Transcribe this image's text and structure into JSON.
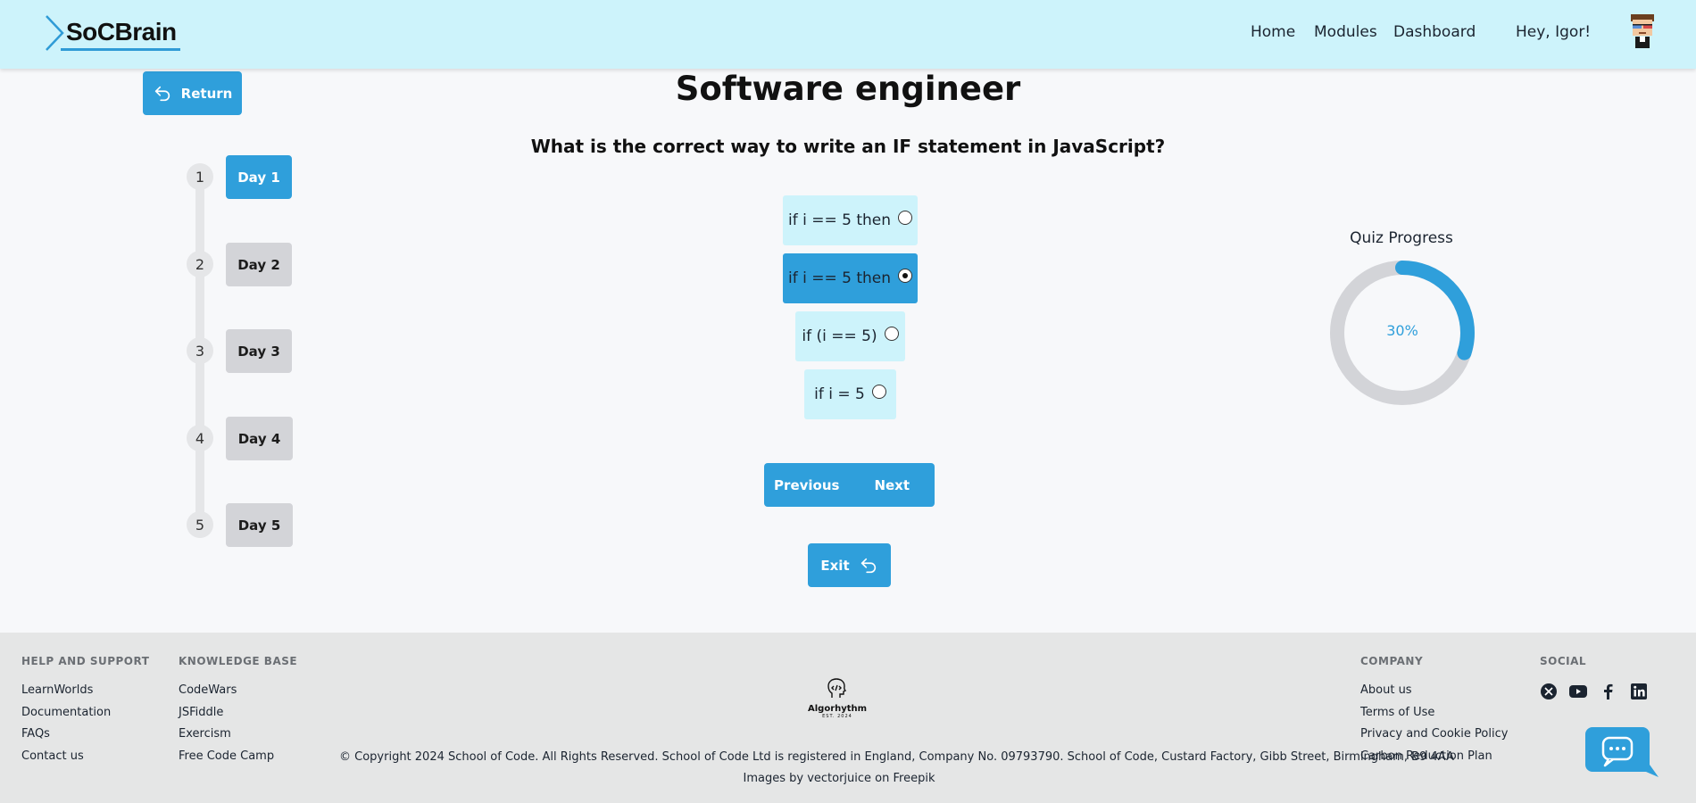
{
  "header": {
    "logo_text": "SoCBrain",
    "nav": [
      "Home",
      "Modules",
      "Dashboard"
    ],
    "greeting": "Hey, Igor!"
  },
  "return_label": "Return",
  "title": "Software engineer",
  "question": "What is the correct way to write an IF statement in JavaScript?",
  "days": [
    {
      "num": "1",
      "label": "Day 1",
      "active": true
    },
    {
      "num": "2",
      "label": "Day 2",
      "active": false
    },
    {
      "num": "3",
      "label": "Day 3",
      "active": false
    },
    {
      "num": "4",
      "label": "Day 4",
      "active": false
    },
    {
      "num": "5",
      "label": "Day 5",
      "active": false
    }
  ],
  "options": [
    {
      "label": "if i == 5 then",
      "selected": false
    },
    {
      "label": "if i == 5 then",
      "selected": true
    },
    {
      "label": "if (i == 5)",
      "selected": false
    },
    {
      "label": "if i = 5",
      "selected": false
    }
  ],
  "pager": {
    "previous": "Previous",
    "next": "Next"
  },
  "exit_label": "Exit",
  "progress": {
    "label": "Quiz Progress",
    "value_text": "30%",
    "fraction": 0.3
  },
  "footer": {
    "help": {
      "heading": "HELP AND SUPPORT",
      "links": [
        "LearnWorlds",
        "Documentation",
        "FAQs",
        "Contact us"
      ]
    },
    "knowledge": {
      "heading": "KNOWLEDGE BASE",
      "links": [
        "CodeWars",
        "JSFiddle",
        "Exercism",
        "Free Code Camp"
      ]
    },
    "company": {
      "heading": "COMPANY",
      "links": [
        "About us",
        "Terms of Use",
        "Privacy and Cookie Policy",
        "Carbon Reduction Plan"
      ]
    },
    "social_heading": "SOCIAL",
    "social_icons": [
      "x-icon",
      "youtube-icon",
      "facebook-icon",
      "linkedin-icon"
    ],
    "brand_name": "Algorhythm",
    "brand_est": "EST. 2024",
    "copyright": "© Copyright 2024 School of Code. All Rights Reserved. School of Code Ltd is registered in England, Company No. 09793790. School of Code, Custard Factory, Gibb Street, Birmingham, B9 4AA",
    "images_credit": "Images by vectorjuice on Freepik"
  },
  "colors": {
    "accent": "#2f9fdb",
    "header_bg": "#cdf3fb",
    "option_bg": "#cdf3fb",
    "inactive_day": "#d3d4d8",
    "footer_bg": "#e5e6e6"
  }
}
